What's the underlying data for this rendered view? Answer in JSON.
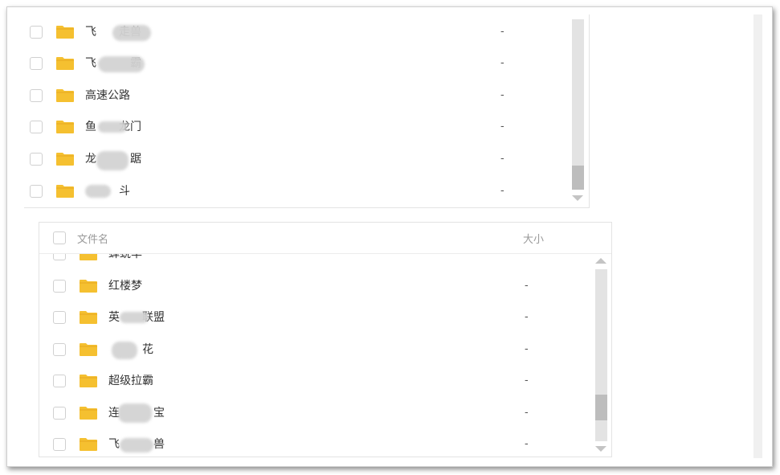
{
  "top_panel": {
    "rows": [
      {
        "name": "飞  走兽",
        "size": "-"
      },
      {
        "name": "飞   霸",
        "size": "-"
      },
      {
        "name": "高速公路",
        "size": "-"
      },
      {
        "name": "鱼  龙门",
        "size": "-"
      },
      {
        "name": "龙   踞",
        "size": "-"
      },
      {
        "name": "   斗",
        "size": "-"
      }
    ]
  },
  "bottom_panel": {
    "header": {
      "name_label": "文件名",
      "size_label": "大小"
    },
    "rows": [
      {
        "name": "蝉蜕羊",
        "size": "-"
      },
      {
        "name": "红楼梦",
        "size": "-"
      },
      {
        "name": "英  联盟",
        "size": "-"
      },
      {
        "name": "   花",
        "size": "-"
      },
      {
        "name": "超级拉霸",
        "size": "-"
      },
      {
        "name": "连   宝",
        "size": "-"
      },
      {
        "name": "飞   兽",
        "size": "-"
      }
    ]
  },
  "colors": {
    "folder": "#f5c030",
    "folder_tab": "#e8a91f",
    "scroll_track": "#e3e3e3",
    "scroll_thumb": "#bdbdbd"
  },
  "scroll": {
    "top_panel_position_fraction": 0.85,
    "bottom_panel_position_fraction": 0.9
  }
}
